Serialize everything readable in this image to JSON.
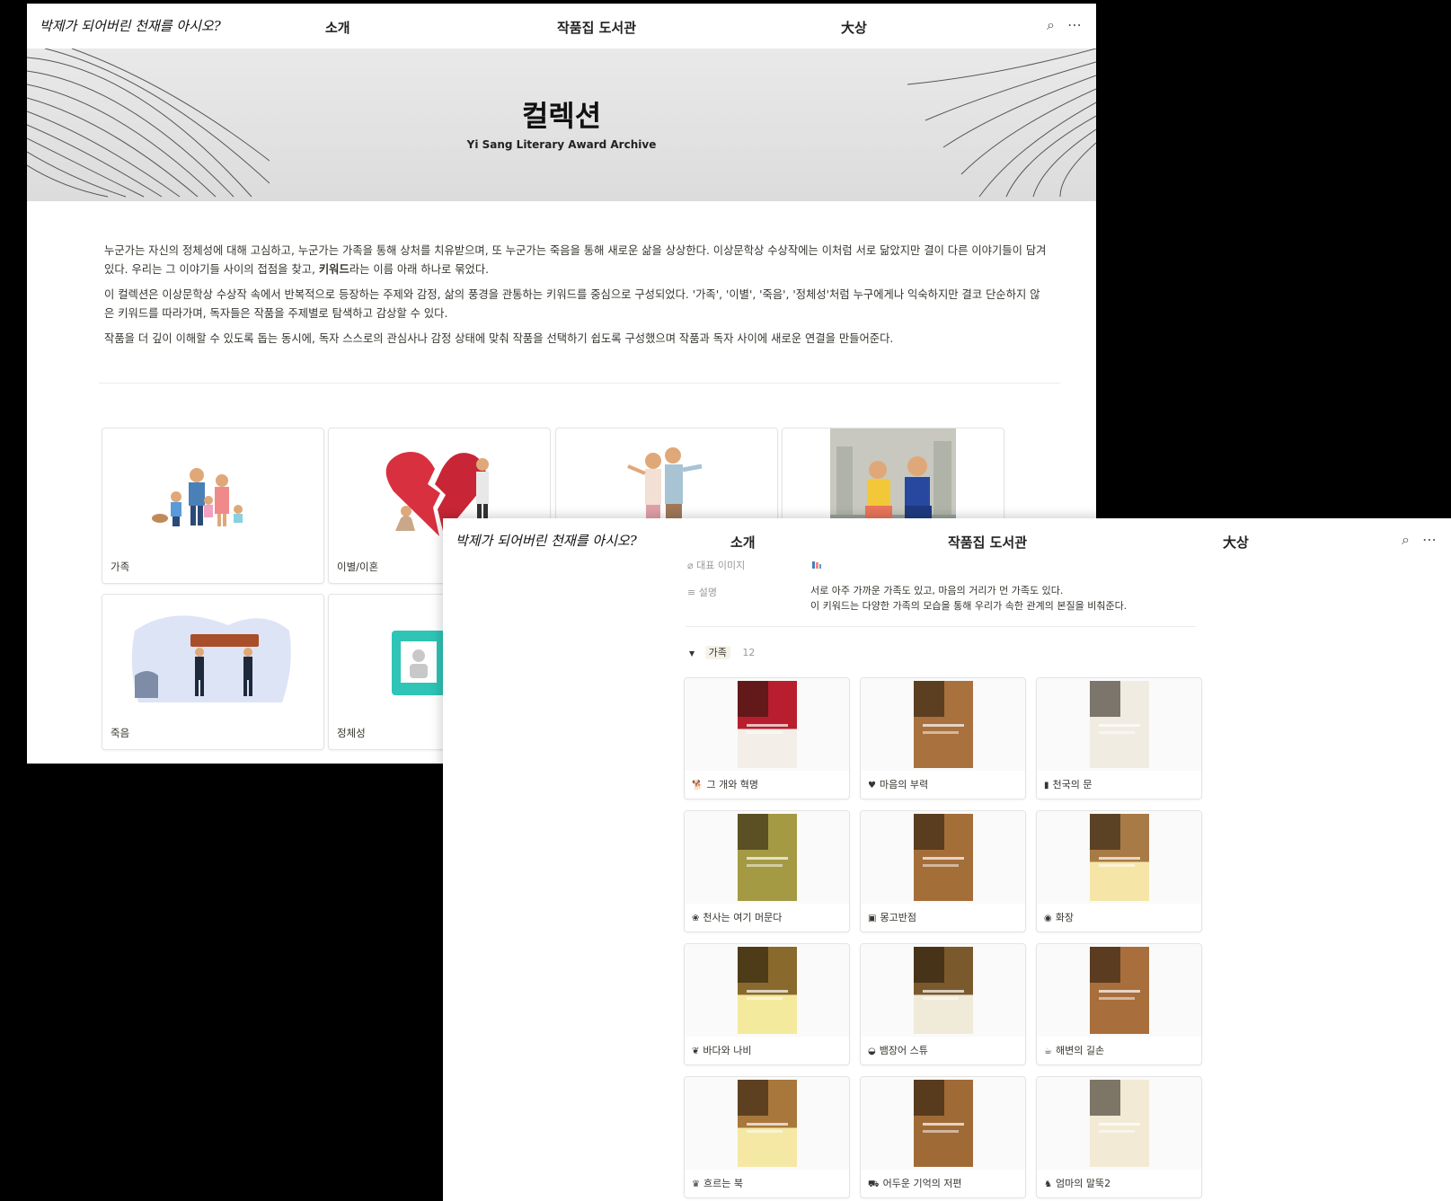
{
  "nav": {
    "brand": "박제가 되어버린 천재를 아시오?",
    "links": [
      "소개",
      "작품집 도서관",
      "大상"
    ]
  },
  "banner": {
    "title": "컬렉션",
    "subtitle": "Yi Sang Literary Award Archive"
  },
  "intro": {
    "p1_before": "누군가는 자신의 정체성에 대해 고심하고, 누군가는 가족을 통해 상처를 치유받으며, 또 누군가는 죽음을 통해 새로운 삶을 상상한다. 이상문학상 수상작에는 이처럼 서로 닮았지만 결이 다른 이야기들이 담겨 있다. 우리는 그 이야기들 사이의 접점을 찾고, ",
    "p1_bold": "키워드",
    "p1_after": "라는 이름 아래 하나로 묶었다.",
    "p2": "이 컬렉션은 이상문학상 수상작 속에서 반복적으로 등장하는 주제와 감정, 삶의 풍경을 관통하는 키워드를 중심으로 구성되었다. '가족', '이별', '죽음', '정체성'처럼 누구에게나 익숙하지만 결코 단순하지 않은 키워드를 따라가며, 독자들은 작품을 주제별로 탐색하고 감상할 수 있다.",
    "p3": "작품을 더 깊이 이해할 수 있도록 돕는 동시에, 독자 스스로의 관심사나 감정 상태에 맞춰 작품을 선택하기 쉽도록 구성했으며 작품과 독자 사이에 새로운 연결을 만들어준다."
  },
  "collections": [
    "가족",
    "이별/이혼",
    "죽음",
    "정체성"
  ],
  "detail": {
    "prop_image_label": "대표 이미지",
    "prop_desc_label": "설명",
    "desc_line1": "서로 아주 가까운 가족도 있고, 마음의 거리가 먼 가족도 있다.",
    "desc_line2": "이 키워드는 다양한 가족의 모습을 통해 우리가 속한 관계의 본질을 비춰준다.",
    "group_label": "가족",
    "group_count": "12",
    "books": [
      {
        "title": "그 개와 혁명",
        "icon": "🐕",
        "cover": "#b81e2e",
        "bg": "#f3efe8"
      },
      {
        "title": "마음의 부력",
        "icon": "♥",
        "cover": "#a8713d",
        "bg": "#a8713d"
      },
      {
        "title": "천국의 문",
        "icon": "▮",
        "cover": "#f0ece2",
        "bg": "#f0ece2"
      },
      {
        "title": "천사는 여기 머문다",
        "icon": "❀",
        "cover": "#a49a44",
        "bg": "#a49a44"
      },
      {
        "title": "몽고반점",
        "icon": "▣",
        "cover": "#a46e39",
        "bg": "#a46e39"
      },
      {
        "title": "화장",
        "icon": "◉",
        "cover": "#a87a45",
        "bg": "#f5e6a8"
      },
      {
        "title": "바다와 나비",
        "icon": "❦",
        "cover": "#8a6a2c",
        "bg": "#f4ea9e"
      },
      {
        "title": "뱀장어 스튜",
        "icon": "◒",
        "cover": "#7a5a2c",
        "bg": "#f0ead8"
      },
      {
        "title": "해변의 길손",
        "icon": "☕",
        "cover": "#a86e3c",
        "bg": "#a86e3c"
      },
      {
        "title": "흐르는 북",
        "icon": "♛",
        "cover": "#a8773c",
        "bg": "#f4e8a4"
      },
      {
        "title": "어두운 기억의 저편",
        "icon": "⛟",
        "cover": "#a06a36",
        "bg": "#a06a36"
      },
      {
        "title": "엄마의 말뚝2",
        "icon": "♞",
        "cover": "#f2ead4",
        "bg": "#f2ead4"
      }
    ]
  }
}
